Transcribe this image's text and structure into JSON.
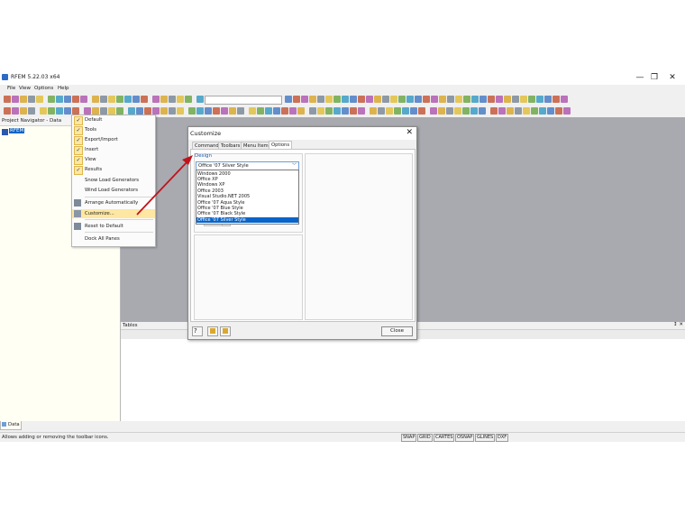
{
  "window": {
    "title": "RFEM 5.22.03 x64",
    "controls": [
      "—",
      "❐",
      "✕"
    ]
  },
  "menubar": [
    "File",
    "View",
    "Options",
    "Help"
  ],
  "navigator": {
    "title": "Project Navigator - Data",
    "root_item": "RFEM",
    "bottom_tab": "Data"
  },
  "tables": {
    "title": "Tables",
    "controls": "↕ ✕"
  },
  "context_menu": {
    "items": [
      {
        "label": "Default",
        "checked": true
      },
      {
        "label": "Tools",
        "checked": true
      },
      {
        "label": "Export/Import",
        "checked": true
      },
      {
        "label": "Insert",
        "checked": true
      },
      {
        "label": "View",
        "checked": true
      },
      {
        "label": "Results",
        "checked": true
      },
      {
        "label": "Snow Load Generators",
        "checked": false
      },
      {
        "label": "Wind Load Generators",
        "checked": false
      },
      {
        "label": "Arrange Automatically",
        "checked": false
      },
      {
        "label": "Customize...",
        "checked": false,
        "highlighted": true
      },
      {
        "label": "Reset to Default",
        "checked": false
      },
      {
        "label": "Dock All Panes",
        "checked": false
      }
    ]
  },
  "dialog": {
    "title": "Customize",
    "close_glyph": "✕",
    "tabs": [
      "Commands",
      "Toolbars",
      "Menu Items",
      "Options"
    ],
    "active_tab": "Options",
    "design_label": "Design",
    "design_selected": "Office '07 Silver Style",
    "design_options": [
      "Windows 2000",
      "Office XP",
      "Windows XP",
      "Office 2003",
      "Visual Studio.NET 2005",
      "Office '07 Aqua Style",
      "Office '07 Blue Style",
      "Office '07 Black Style",
      "Office '07 Silver Style"
    ],
    "close_button": "Close"
  },
  "status": {
    "message": "Allows adding or removing the toolbar icons.",
    "buttons": [
      "SNAP",
      "GRID",
      "CARTES",
      "OSNAP",
      "GLINES",
      "DXF"
    ]
  },
  "colors": {
    "accent_arrow": "#c0141c",
    "selection": "#0a64c8",
    "menu_highlight": "#fde7a2",
    "workspace": "#a8aab0"
  }
}
